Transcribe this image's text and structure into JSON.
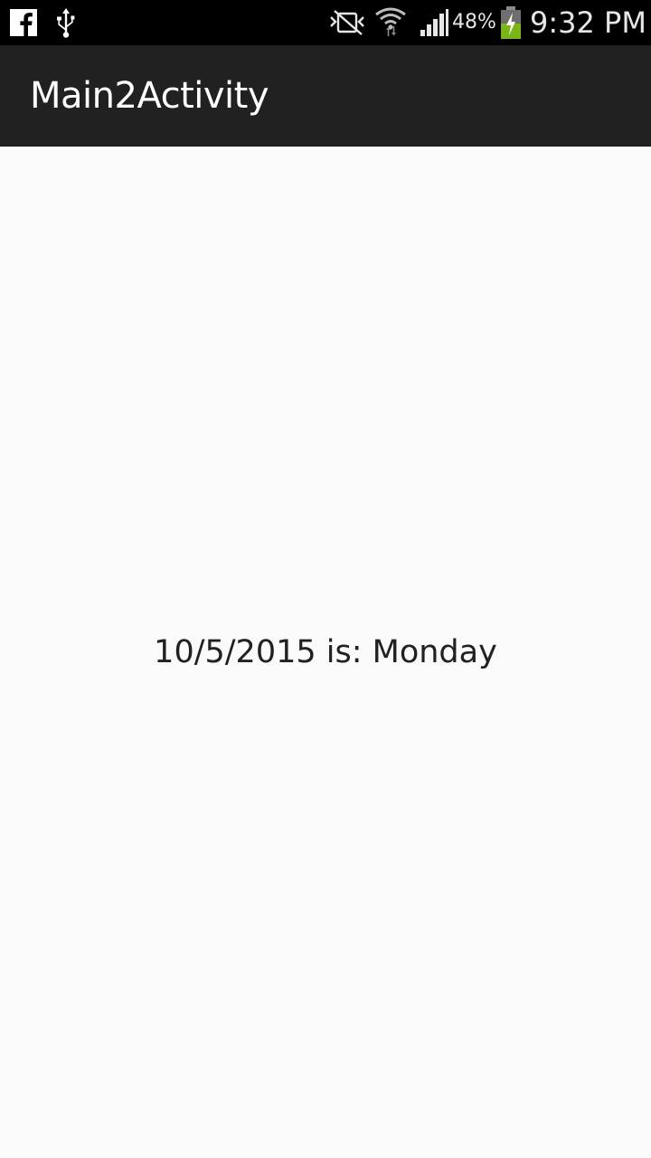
{
  "status_bar": {
    "icons_left": [
      "facebook-icon",
      "usb-icon"
    ],
    "icons_right": [
      "silent-mode-icon",
      "wifi-icon",
      "signal-icon",
      "battery-charging-icon"
    ],
    "battery_percent": "48%",
    "time": "9:32 PM"
  },
  "app_bar": {
    "title": "Main2Activity"
  },
  "content": {
    "result_text": "10/5/2015 is: Monday"
  },
  "colors": {
    "status_bar_bg": "#000000",
    "app_bar_bg": "#212121",
    "content_bg": "#fafafa",
    "text_primary": "#212121",
    "battery_fill": "#7cb518"
  }
}
